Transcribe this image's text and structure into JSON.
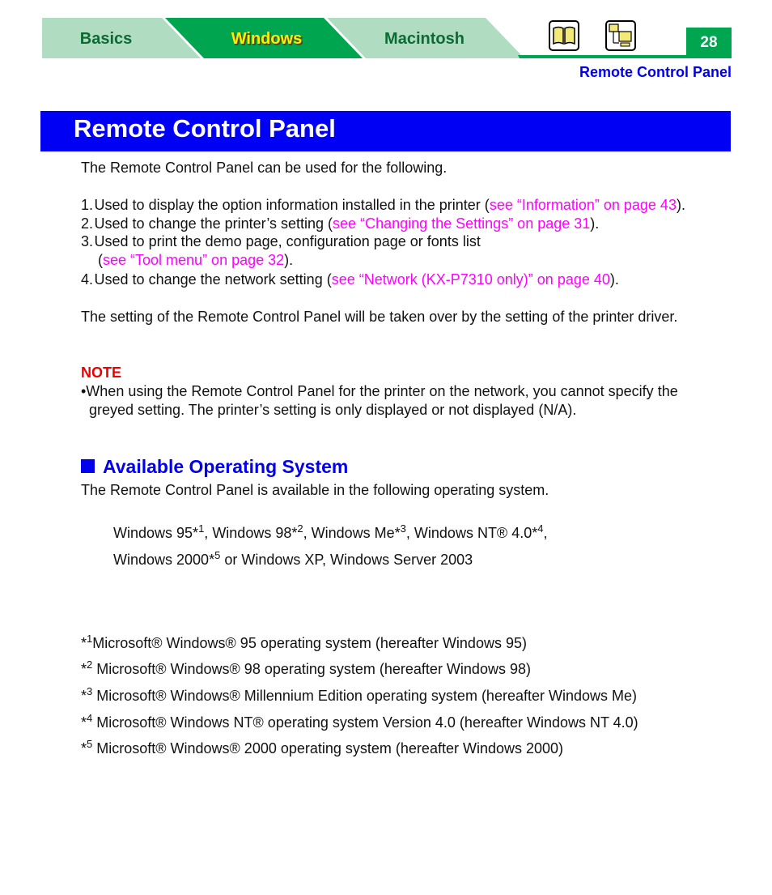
{
  "nav": {
    "tabs": [
      {
        "label": "Basics",
        "active": false
      },
      {
        "label": "Windows",
        "active": true
      },
      {
        "label": "Macintosh",
        "active": false
      }
    ],
    "icons": [
      "book-icon",
      "network-computer-icon"
    ],
    "page_number": "28"
  },
  "running_head": "Remote Control Panel",
  "title": "Remote Control Panel",
  "intro": "The Remote Control Panel can be used for the following.",
  "list": [
    {
      "num": "1.",
      "text": "Used to display the option information installed in the printer (",
      "link": "see “Information” on page 43",
      "after": ")."
    },
    {
      "num": "2.",
      "text": "Used to change the printer’s setting (",
      "link": "see “Changing the Settings” on page 31",
      "after": ")."
    },
    {
      "num": "3.",
      "text": "Used to print the demo page, configuration page or fonts list",
      "cont_pre": "(",
      "link": "see “Tool menu” on page 32",
      "after": ")."
    },
    {
      "num": "4.",
      "text": "Used to change the network setting (",
      "link": "see “Network (KX-P7310 only)” on page 40",
      "after": ")."
    }
  ],
  "takeover": "The setting of the Remote Control Panel will be taken over by the setting of the printer driver.",
  "note": {
    "label": "NOTE",
    "line1": "•When using the Remote Control Panel for the printer on the network, you cannot specify the",
    "line2": "greyed setting. The printer’s setting is only displayed or not displayed (N/A)."
  },
  "section": {
    "heading": "Available Operating System",
    "intro": "The Remote Control Panel is available in the following operating system.",
    "os": [
      {
        "name": "Windows 95",
        "mark": "*",
        "ref": "1",
        "sep": ", "
      },
      {
        "name": "Windows 98",
        "mark": "*",
        "ref": "2",
        "sep": ", "
      },
      {
        "name": "Windows Me",
        "mark": "*",
        "ref": "3",
        "sep": ", "
      },
      {
        "name": "Windows NT® 4.0",
        "mark": "*",
        "ref": "4",
        "sep": ","
      },
      {
        "name": "Windows 2000",
        "mark": "*",
        "ref": "5",
        "sep": " or Windows XP, Windows Server 2003"
      }
    ]
  },
  "footnotes": [
    {
      "mark": "*",
      "ref": "1",
      "text": "Microsoft® Windows® 95 operating system (hereafter Windows 95)"
    },
    {
      "mark": "*",
      "ref": "2",
      "text": " Microsoft® Windows® 98 operating system (hereafter Windows 98)"
    },
    {
      "mark": "*",
      "ref": "3",
      "text": " Microsoft® Windows® Millennium Edition operating system (hereafter Windows Me)"
    },
    {
      "mark": "*",
      "ref": "4",
      "text": " Microsoft® Windows NT® operating system Version 4.0 (hereafter Windows NT 4.0)"
    },
    {
      "mark": "*",
      "ref": "5",
      "text": " Microsoft® Windows® 2000 operating system (hereafter Windows 2000)"
    }
  ],
  "colors": {
    "tab_light": "#b0dcc2",
    "tab_active": "#00a550",
    "title_bg": "#0000f5",
    "link": "#ff00ff",
    "note": "#ee0000"
  }
}
